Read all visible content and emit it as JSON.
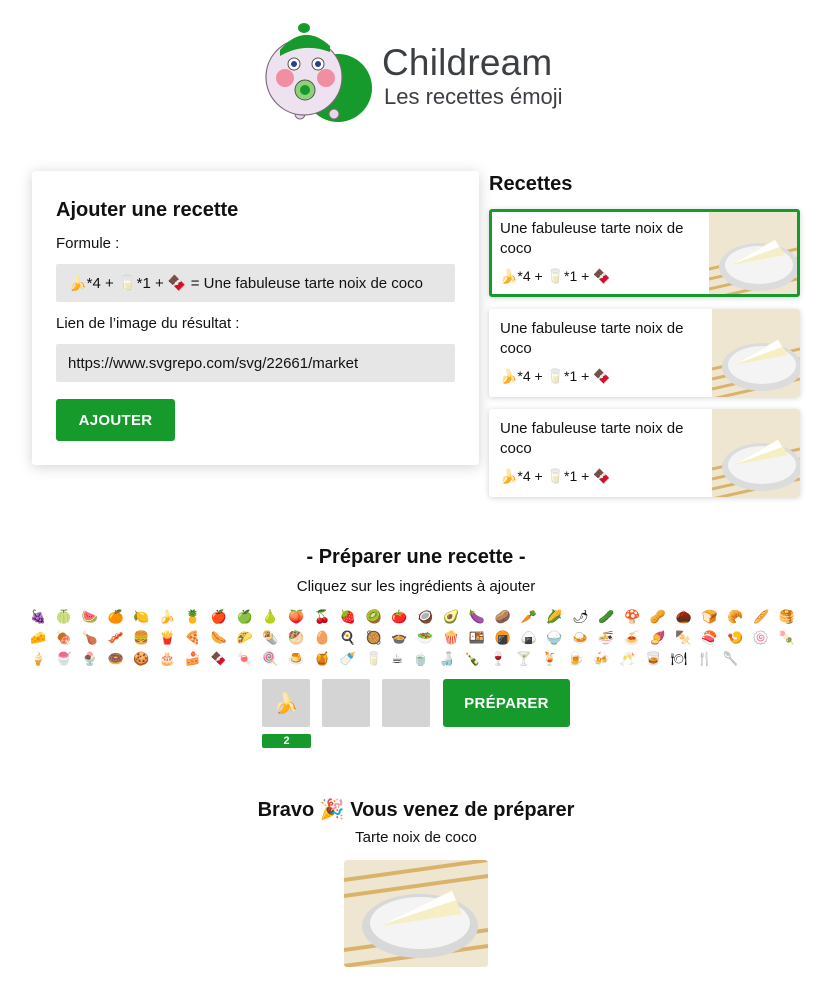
{
  "brand": {
    "name": "Childream",
    "subtitle": "Les recettes émoji"
  },
  "add_form": {
    "title": "Ajouter une recette",
    "formula_label": "Formule :",
    "formula_value": "🍌*4 + 🥛*1 + 🍫 = Une fabuleuse tarte noix de coco",
    "image_label": "Lien de l’image du résultat :",
    "image_value": "https://www.svgrepo.com/svg/22661/market",
    "submit_label": "AJOUTER"
  },
  "recipes": {
    "title": "Recettes",
    "items": [
      {
        "name": "Une fabuleuse tarte noix de coco",
        "formula": "🍌*4 + 🥛*1 + 🍫"
      },
      {
        "name": "Une fabuleuse tarte noix de coco",
        "formula": "🍌*4 + 🥛*1 + 🍫"
      },
      {
        "name": "Une fabuleuse tarte noix de coco",
        "formula": "🍌*4 + 🥛*1 + 🍫"
      }
    ]
  },
  "prepare": {
    "title": "- Préparer une recette -",
    "subtitle": "Cliquez sur les ingrédients à ajouter",
    "ingredients": [
      "🍇",
      "🍈",
      "🍉",
      "🍊",
      "🍋",
      "🍌",
      "🍍",
      "🍎",
      "🍏",
      "🍐",
      "🍑",
      "🍒",
      "🍓",
      "🥝",
      "🍅",
      "🥥",
      "🥑",
      "🍆",
      "🥔",
      "🥕",
      "🌽",
      "🌶",
      "🥒",
      "🍄",
      "🥜",
      "🌰",
      "🍞",
      "🥐",
      "🥖",
      "🥞",
      "🧀",
      "🍖",
      "🍗",
      "🥓",
      "🍔",
      "🍟",
      "🍕",
      "🌭",
      "🌮",
      "🌯",
      "🥙",
      "🥚",
      "🍳",
      "🥘",
      "🍲",
      "🥗",
      "🍿",
      "🍱",
      "🍘",
      "🍙",
      "🍚",
      "🍛",
      "🍜",
      "🍝",
      "🍠",
      "🍢",
      "🍣",
      "🍤",
      "🍥",
      "🍡",
      "🍦",
      "🍧",
      "🍨",
      "🍩",
      "🍪",
      "🎂",
      "🍰",
      "🍫",
      "🍬",
      "🍭",
      "🍮",
      "🍯",
      "🍼",
      "🥛",
      "☕",
      "🍵",
      "🍶",
      "🍾",
      "🍷",
      "🍸",
      "🍹",
      "🍺",
      "🍻",
      "🥂",
      "🥃",
      "🍽",
      "🍴",
      "🥄"
    ],
    "slots": [
      "🍌",
      "",
      ""
    ],
    "slot_count": "2",
    "prepare_label": "PRÉPARER"
  },
  "result": {
    "title": "Bravo 🎉 Vous venez de préparer",
    "name": "Tarte noix de coco"
  },
  "colors": {
    "accent": "#159a2b",
    "field": "#e6e6e6",
    "slot": "#d4d4d4"
  }
}
